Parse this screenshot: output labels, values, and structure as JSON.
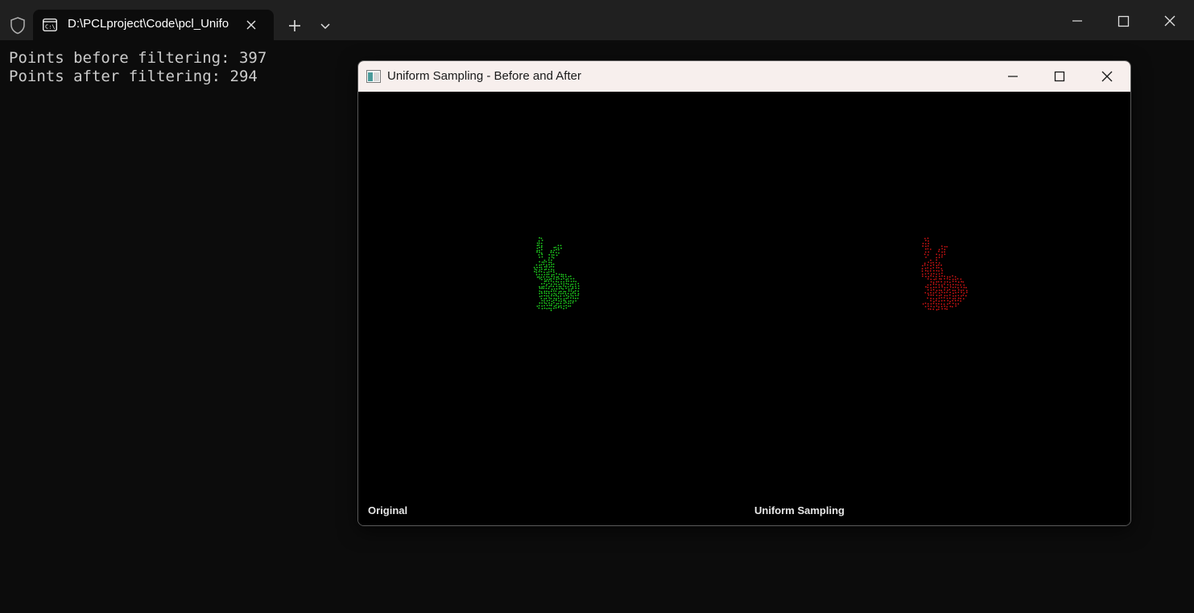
{
  "terminal": {
    "tab_title": "D:\\PCLproject\\Code\\pcl_Unifo",
    "output_lines": [
      "Points before filtering: 397",
      "Points after filtering: 294"
    ]
  },
  "viewer": {
    "title": "Uniform Sampling - Before and After",
    "left_viewport_label": "Original",
    "right_viewport_label": "Uniform Sampling",
    "left_cloud_color": "#1fd11f",
    "right_cloud_color": "#d11414"
  },
  "icons": {
    "shield": "shield-icon",
    "terminal_tab": "command-prompt-icon",
    "close_tab": "close-icon",
    "new_tab": "plus-icon",
    "dropdown": "chevron-down-icon",
    "minimize": "minimize-icon",
    "maximize": "maximize-icon",
    "close": "close-icon"
  }
}
